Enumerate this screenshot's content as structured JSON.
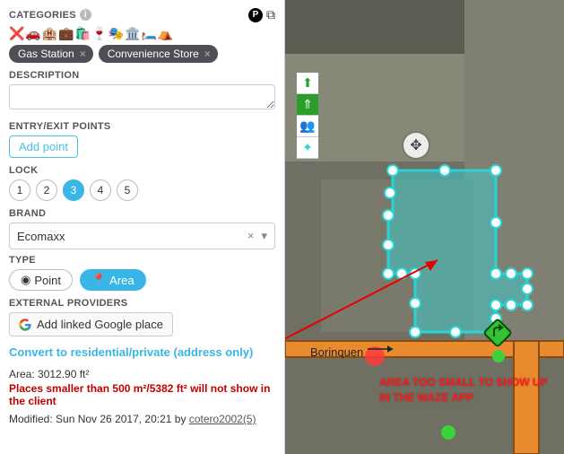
{
  "headers": {
    "categories": "CATEGORIES",
    "description": "DESCRIPTION",
    "entry": "ENTRY/EXIT POINTS",
    "lock": "LOCK",
    "brand": "BRAND",
    "type": "TYPE",
    "external": "EXTERNAL PROVIDERS"
  },
  "tags": {
    "a": "Gas Station",
    "b": "Convenience Store"
  },
  "description_value": "",
  "entry": {
    "add": "Add point"
  },
  "lock": {
    "l1": "1",
    "l2": "2",
    "l3": "3",
    "l4": "4",
    "l5": "5",
    "selected": "3"
  },
  "brand": {
    "value": "Ecomaxx"
  },
  "type": {
    "point": "Point",
    "area": "Area",
    "selected": "Area"
  },
  "external": {
    "add": "Add linked Google place"
  },
  "convert_link": "Convert to residential/private (address only)",
  "meta": {
    "area": "Area: 3012.90 ft²",
    "warning": "Places smaller than 500 m²/5382 ft² will not show in the client",
    "modified": "Modified: Sun Nov 26 2017, 20:21 by ",
    "modifier": "cotero2002(5)"
  },
  "map": {
    "street": "Borinquen",
    "note_l1": "AREA TOO SMALL TO SHOW UP",
    "note_l2": "IN THE WAZE APP"
  }
}
